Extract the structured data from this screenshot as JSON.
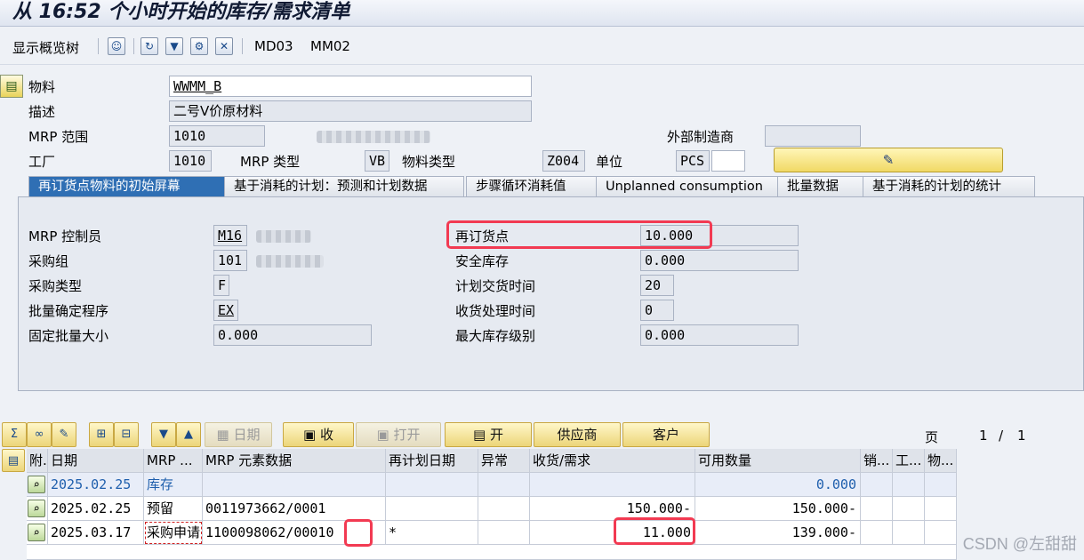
{
  "title": "从 16:52 个小时开始的库存/需求清单",
  "toolbar": {
    "overview_label": "显示概览树",
    "md03_label": "MD03",
    "mm02_label": "MM02"
  },
  "header": {
    "material_label": "物料",
    "material_value": "WWMM_B",
    "desc_label": "描述",
    "desc_value": "二号V价原材料",
    "mrp_area_label": "MRP 范围",
    "mrp_area_value": "1010",
    "ext_mfr_label": "外部制造商",
    "plant_label": "工厂",
    "plant_value": "1010",
    "mrp_type_label": "MRP 类型",
    "mrp_type_value": "VB",
    "mat_type_label": "物料类型",
    "mat_type_value": "Z004",
    "unit_label": "单位",
    "unit_value": "PCS"
  },
  "tabs": [
    {
      "label": "再订货点物料的初始屏幕"
    },
    {
      "label": "基于消耗的计划：预测和计划数据"
    },
    {
      "label": "步骤循环消耗值"
    },
    {
      "label": "Unplanned consumption"
    },
    {
      "label": "批量数据"
    },
    {
      "label": "基于消耗的计划的统计"
    }
  ],
  "panel": {
    "mrp_controller_label": "MRP 控制员",
    "mrp_controller_value": "M16",
    "purch_group_label": "采购组",
    "purch_group_value": "101",
    "proc_type_label": "采购类型",
    "proc_type_value": "F",
    "lot_size_label": "批量确定程序",
    "lot_size_value": "EX",
    "fixed_lot_label": "固定批量大小",
    "fixed_lot_value": "0.000",
    "reorder_label": "再订货点",
    "reorder_value": "10.000",
    "safety_label": "安全库存",
    "safety_value": "0.000",
    "deliv_label": "计划交货时间",
    "deliv_value": "20",
    "gr_label": "收货处理时间",
    "gr_value": "0",
    "max_label": "最大库存级别",
    "max_value": "0.000"
  },
  "alv": {
    "date_label": "日期",
    "receive_label": "收",
    "open_label": "打开",
    "start_label": "开",
    "supplier_label": "供应商",
    "customer_label": "客户",
    "page_label": "页",
    "page_current": "1",
    "page_sep": "/",
    "page_total": "1"
  },
  "table": {
    "headers": [
      "附.",
      "日期",
      "MRP ...",
      "MRP 元素数据",
      "再计划日期",
      "异常",
      "收货/需求",
      "可用数量",
      "销...",
      "工...",
      "物..."
    ],
    "rows": [
      {
        "date": "2025.02.25",
        "mrp": "库存",
        "data": "",
        "resched": "",
        "exc": "",
        "qty": "",
        "avail": "0.000"
      },
      {
        "date": "2025.02.25",
        "mrp": "预留",
        "data": "0011973662/0001",
        "resched": "",
        "exc": "",
        "qty": "150.000-",
        "avail": "150.000-"
      },
      {
        "date": "2025.03.17",
        "mrp": "采购申请",
        "data": "1100098062/00010",
        "resched": "*",
        "exc": "",
        "qty": "11.000",
        "avail": "139.000-"
      }
    ]
  },
  "watermark": "CSDN @左甜甜"
}
